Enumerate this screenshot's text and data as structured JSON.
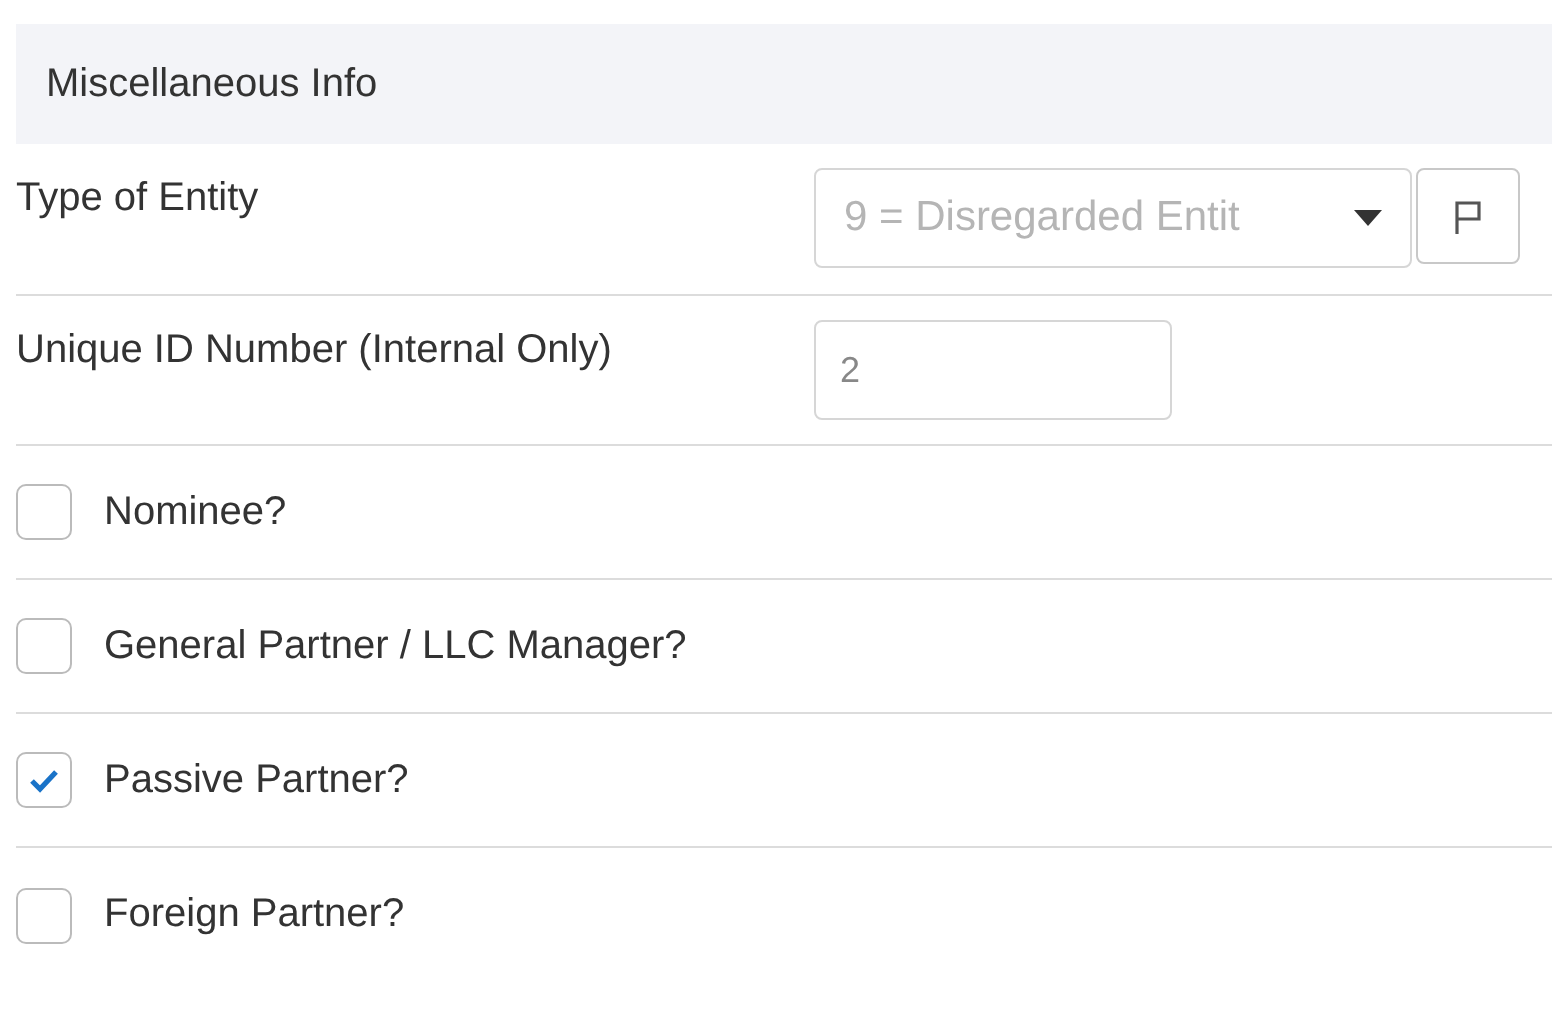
{
  "section": {
    "title": "Miscellaneous Info"
  },
  "type_of_entity": {
    "label": "Type of Entity",
    "value": "9 = Disregarded Entit",
    "disabled": true
  },
  "unique_id": {
    "label": "Unique ID Number (Internal Only)",
    "value": "2"
  },
  "checkboxes": [
    {
      "label": "Nominee?",
      "checked": false
    },
    {
      "label": "General Partner / LLC Manager?",
      "checked": false
    },
    {
      "label": "Passive Partner?",
      "checked": true
    },
    {
      "label": "Foreign Partner?",
      "checked": false
    }
  ]
}
